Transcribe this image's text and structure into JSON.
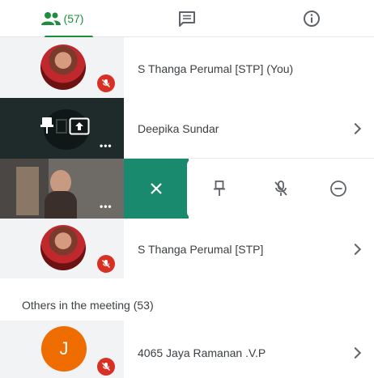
{
  "tabs": {
    "people_count": "(57)",
    "people_icon": "people-icon",
    "chat_icon": "chat-icon",
    "info_icon": "info-icon"
  },
  "participants": [
    {
      "name": "S Thanga Perumal [STP] (You)",
      "muted": true
    },
    {
      "name": "Deepika Sundar",
      "presenting": true
    },
    {
      "name": "",
      "has_video": true
    },
    {
      "name": "S Thanga Perumal [STP]",
      "muted": true
    }
  ],
  "action_strip": {
    "close_icon": "close-icon",
    "pin_icon": "pin-icon",
    "mute_icon": "mic-off-icon",
    "remove_icon": "remove-icon"
  },
  "others_section": {
    "header": "Others in the meeting (53)",
    "items": [
      {
        "initial": "J",
        "name": "4065 Jaya Ramanan .V.P",
        "muted": true
      }
    ]
  },
  "colors": {
    "accent": "#1e8e3e",
    "action_teal": "#1a8a6e",
    "mute_red": "#d93025",
    "avatar_orange": "#ef6c00"
  }
}
